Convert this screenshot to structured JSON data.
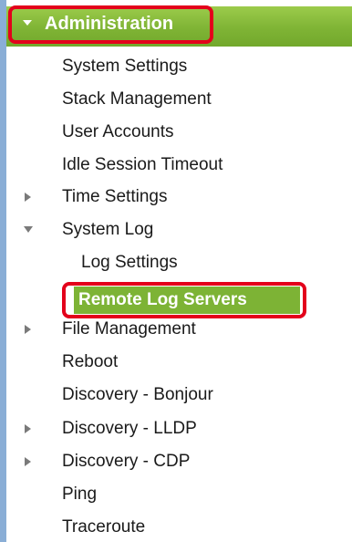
{
  "menu": {
    "title": "Administration",
    "items": [
      {
        "label": "System Settings"
      },
      {
        "label": "Stack Management"
      },
      {
        "label": "User Accounts"
      },
      {
        "label": "Idle Session Timeout"
      },
      {
        "label": "Time Settings",
        "expander": "collapsed"
      },
      {
        "label": "System Log",
        "expander": "expanded",
        "children": [
          {
            "label": "Log Settings"
          },
          {
            "label": "Remote Log Servers",
            "selected": true
          }
        ]
      },
      {
        "label": "File Management",
        "expander": "collapsed"
      },
      {
        "label": "Reboot"
      },
      {
        "label": "Discovery - Bonjour"
      },
      {
        "label": "Discovery - LLDP",
        "expander": "collapsed"
      },
      {
        "label": "Discovery - CDP",
        "expander": "collapsed"
      },
      {
        "label": "Ping"
      },
      {
        "label": "Traceroute"
      }
    ]
  },
  "colors": {
    "header_green": "#7fb435",
    "selected_green": "#7db335",
    "highlight_red": "#e3001b",
    "border_blue": "#8aaed6"
  },
  "icons": {
    "collapsed": "triangle-right-icon",
    "expanded": "triangle-down-icon"
  }
}
